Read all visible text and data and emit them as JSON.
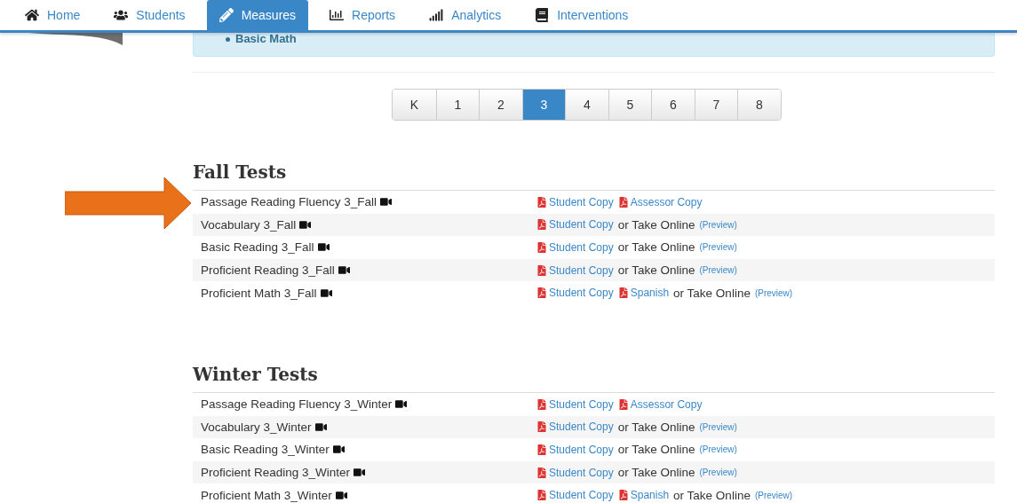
{
  "nav": {
    "tabs": [
      {
        "label": "Home",
        "selected": false
      },
      {
        "label": "Students",
        "selected": false
      },
      {
        "label": "Measures",
        "selected": true
      },
      {
        "label": "Reports",
        "selected": false
      },
      {
        "label": "Analytics",
        "selected": false
      },
      {
        "label": "Interventions",
        "selected": false
      }
    ]
  },
  "info_box": {
    "items": [
      "Basic Math"
    ]
  },
  "grades": [
    {
      "label": "K",
      "selected": false
    },
    {
      "label": "1",
      "selected": false
    },
    {
      "label": "2",
      "selected": false
    },
    {
      "label": "3",
      "selected": true
    },
    {
      "label": "4",
      "selected": false
    },
    {
      "label": "5",
      "selected": false
    },
    {
      "label": "6",
      "selected": false
    },
    {
      "label": "7",
      "selected": false
    },
    {
      "label": "8",
      "selected": false
    }
  ],
  "sections": [
    {
      "title": "Fall Tests",
      "rows": [
        {
          "name": "Passage Reading Fluency 3_Fall",
          "items": [
            {
              "kind": "pdf",
              "label": "Student Copy"
            },
            {
              "kind": "pdf",
              "label": "Assessor Copy"
            }
          ]
        },
        {
          "name": "Vocabulary 3_Fall",
          "items": [
            {
              "kind": "pdf",
              "label": "Student Copy"
            },
            {
              "kind": "text",
              "label": "or Take Online"
            },
            {
              "kind": "preview",
              "label": "(Preview)"
            }
          ]
        },
        {
          "name": "Basic Reading 3_Fall",
          "items": [
            {
              "kind": "pdf",
              "label": "Student Copy"
            },
            {
              "kind": "text",
              "label": "or Take Online"
            },
            {
              "kind": "preview",
              "label": "(Preview)"
            }
          ]
        },
        {
          "name": "Proficient Reading 3_Fall",
          "items": [
            {
              "kind": "pdf",
              "label": "Student Copy"
            },
            {
              "kind": "text",
              "label": "or Take Online"
            },
            {
              "kind": "preview",
              "label": "(Preview)"
            }
          ]
        },
        {
          "name": "Proficient Math 3_Fall",
          "items": [
            {
              "kind": "pdf",
              "label": "Student Copy"
            },
            {
              "kind": "pdf",
              "label": "Spanish"
            },
            {
              "kind": "text",
              "label": "or Take Online"
            },
            {
              "kind": "preview",
              "label": "(Preview)"
            }
          ]
        }
      ]
    },
    {
      "title": "Winter Tests",
      "rows": [
        {
          "name": "Passage Reading Fluency 3_Winter",
          "items": [
            {
              "kind": "pdf",
              "label": "Student Copy"
            },
            {
              "kind": "pdf",
              "label": "Assessor Copy"
            }
          ]
        },
        {
          "name": "Vocabulary 3_Winter",
          "items": [
            {
              "kind": "pdf",
              "label": "Student Copy"
            },
            {
              "kind": "text",
              "label": "or Take Online"
            },
            {
              "kind": "preview",
              "label": "(Preview)"
            }
          ]
        },
        {
          "name": "Basic Reading 3_Winter",
          "items": [
            {
              "kind": "pdf",
              "label": "Student Copy"
            },
            {
              "kind": "text",
              "label": "or Take Online"
            },
            {
              "kind": "preview",
              "label": "(Preview)"
            }
          ]
        },
        {
          "name": "Proficient Reading 3_Winter",
          "items": [
            {
              "kind": "pdf",
              "label": "Student Copy"
            },
            {
              "kind": "text",
              "label": "or Take Online"
            },
            {
              "kind": "preview",
              "label": "(Preview)"
            }
          ]
        },
        {
          "name": "Proficient Math 3_Winter",
          "items": [
            {
              "kind": "pdf",
              "label": "Student Copy"
            },
            {
              "kind": "pdf",
              "label": "Spanish"
            },
            {
              "kind": "text",
              "label": "or Take Online"
            },
            {
              "kind": "preview",
              "label": "(Preview)"
            }
          ]
        }
      ]
    }
  ]
}
